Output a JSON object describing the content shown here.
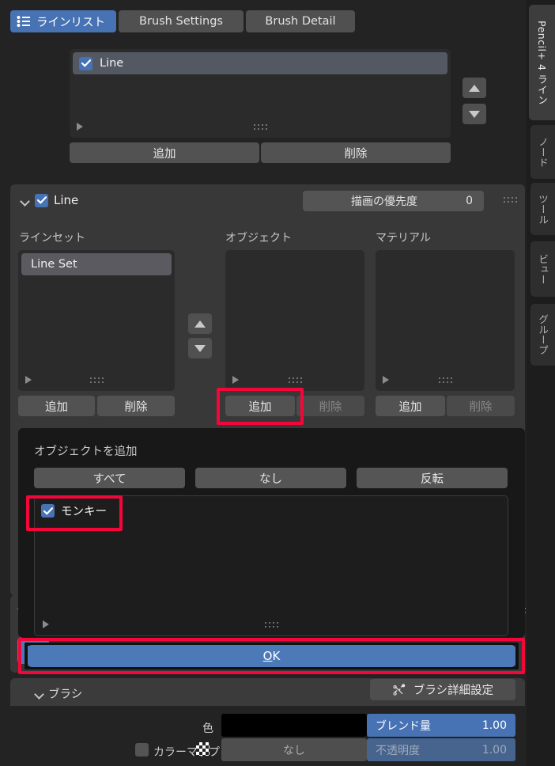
{
  "tabs": [
    {
      "label": "ラインリスト",
      "icon": "list-icon",
      "active": true
    },
    {
      "label": "Brush Settings",
      "active": false
    },
    {
      "label": "Brush Detail",
      "active": false
    }
  ],
  "side_tabs": [
    {
      "label": "Pencil+ 4 ライン",
      "active": true
    },
    {
      "label": "ノード",
      "active": false
    },
    {
      "label": "ツール",
      "active": false
    },
    {
      "label": "ビュー",
      "active": false
    },
    {
      "label": "グループ",
      "active": false
    }
  ],
  "line_list": {
    "items": [
      {
        "label": "Line",
        "checked": true
      }
    ],
    "add_label": "追加",
    "remove_label": "削除",
    "move_up_icon": "arrow-up-icon",
    "move_down_icon": "arrow-down-icon",
    "expand_icon": "expand-triangle-icon",
    "grip_icon": "resize-grip-icon"
  },
  "line_panel": {
    "title": "Line",
    "checked": true,
    "collapse_icon": "chevron-down-icon",
    "priority": {
      "label": "描画の優先度",
      "value": "0"
    },
    "drag_handle_icon": "drag-dots-icon",
    "columns": [
      {
        "header": "ラインセット",
        "items": [
          {
            "label": "Line Set",
            "selected": true
          }
        ],
        "add_label": "追加",
        "remove_label": "削除",
        "add_disabled": false,
        "remove_disabled": false,
        "highlighted": false
      },
      {
        "header": "オブジェクト",
        "items": [],
        "add_label": "追加",
        "remove_label": "削除",
        "add_disabled": false,
        "remove_disabled": true,
        "highlighted": true
      },
      {
        "header": "マテリアル",
        "items": [],
        "add_label": "追加",
        "remove_label": "削除",
        "add_disabled": false,
        "remove_disabled": true,
        "highlighted": false
      }
    ],
    "reorder_up_icon": "arrow-up-icon",
    "reorder_down_icon": "arrow-down-icon"
  },
  "dialog": {
    "title": "オブジェクトを追加",
    "select_all_label": "すべて",
    "select_none_label": "なし",
    "invert_label": "反転",
    "items": [
      {
        "label": "モンキー",
        "checked": true,
        "highlighted": true
      }
    ],
    "ok_label": "OK",
    "ok_accesskey": "O",
    "ok_highlighted": true,
    "expand_icon": "expand-triangle-icon",
    "grip_icon": "resize-grip-icon"
  },
  "brush_section": {
    "title": "ブラシ",
    "collapse_icon": "chevron-down-icon",
    "detail_button": {
      "label": "ブラシ詳細設定",
      "icon": "curve-points-icon"
    },
    "color_row": {
      "label": "色",
      "swatch_color": "#000000",
      "blend_label": "ブレンド量",
      "blend_value": "1.00"
    },
    "colormap_row": {
      "checkbox_checked": false,
      "label": "カラーマップ",
      "texture_icon": "checker-icon",
      "dropdown_value": "なし",
      "opacity_label": "不透明度",
      "opacity_value": "1.00",
      "opacity_disabled": true
    }
  },
  "colors": {
    "accent_blue": "#4772b3",
    "highlight_red": "#f5063a",
    "panel_bg": "#383838",
    "window_bg": "#232323",
    "list_bg": "#2b2b2b"
  }
}
